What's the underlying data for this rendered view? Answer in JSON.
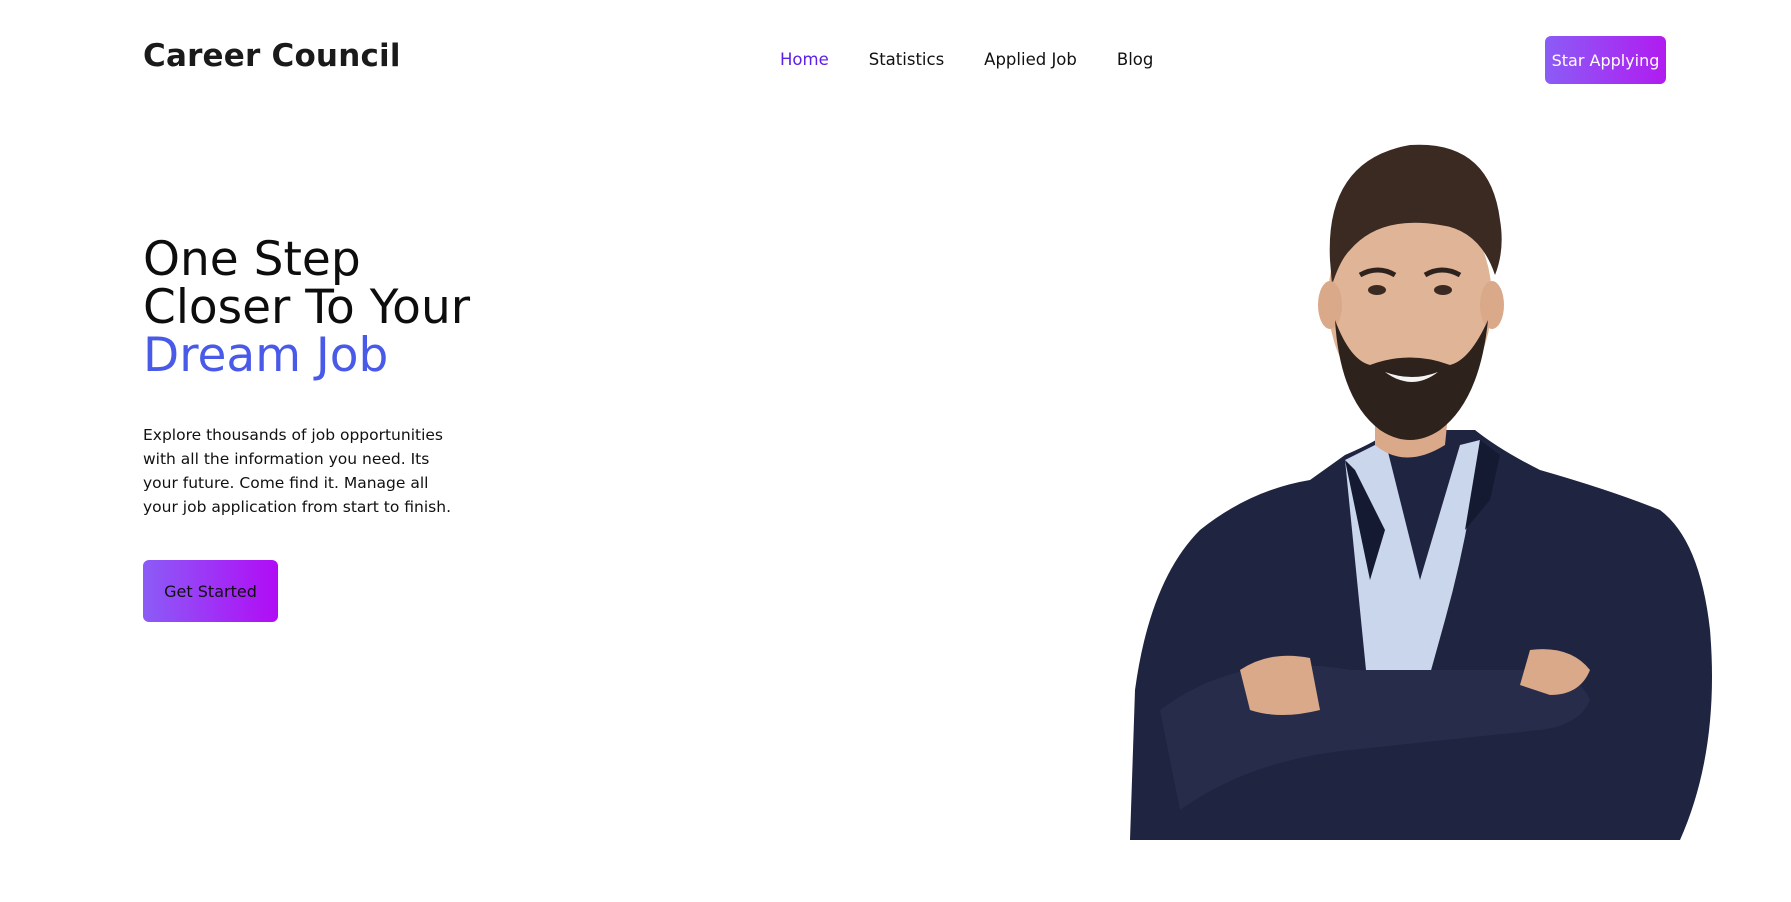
{
  "header": {
    "brand": "Career Council",
    "nav": [
      {
        "label": "Home",
        "active": true
      },
      {
        "label": "Statistics",
        "active": false
      },
      {
        "label": "Applied Job",
        "active": false
      },
      {
        "label": "Blog",
        "active": false
      }
    ],
    "cta_label": "Star Applying"
  },
  "hero": {
    "title_line1": "One Step",
    "title_line2": "Closer To Your",
    "title_accent": "Dream Job",
    "description": "Explore thousands of job opportunities with all the information you need. Its your future. Come find it. Manage all your job application from start to finish.",
    "button_label": "Get Started",
    "image_subject": "smiling-bearded-man-in-suit-arms-crossed"
  },
  "colors": {
    "accent_text": "#4a5ae8",
    "active_nav": "#5b21e6",
    "gradient_start": "#8b5cf6",
    "gradient_end": "#b10cf5"
  }
}
